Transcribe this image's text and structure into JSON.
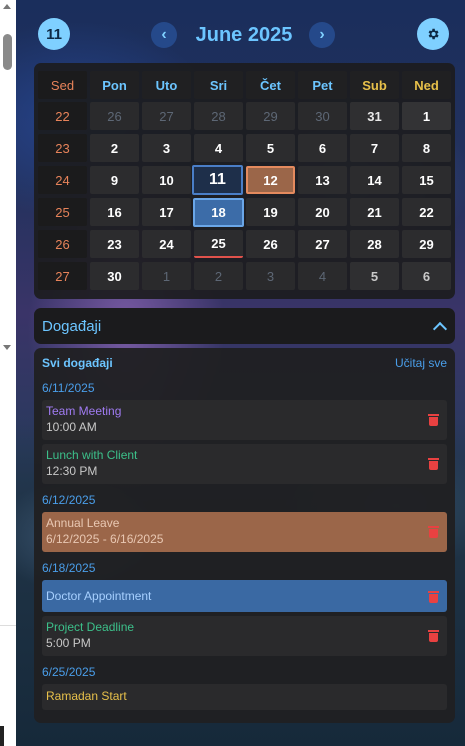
{
  "header": {
    "today_day": "11",
    "month_title": "June 2025",
    "prev_icon": "‹",
    "next_icon": "›"
  },
  "calendar": {
    "headers": [
      "Sed",
      "Pon",
      "Uto",
      "Sri",
      "Čet",
      "Pet",
      "Sub",
      "Ned"
    ],
    "weeks": [
      {
        "week": "22",
        "days": [
          "26",
          "27",
          "28",
          "29",
          "30",
          "31",
          "1"
        ]
      },
      {
        "week": "23",
        "days": [
          "2",
          "3",
          "4",
          "5",
          "6",
          "7",
          "8"
        ]
      },
      {
        "week": "24",
        "days": [
          "9",
          "10",
          "11",
          "12",
          "13",
          "14",
          "15"
        ]
      },
      {
        "week": "25",
        "days": [
          "16",
          "17",
          "18",
          "19",
          "20",
          "21",
          "22"
        ]
      },
      {
        "week": "26",
        "days": [
          "23",
          "24",
          "25",
          "26",
          "27",
          "28",
          "29"
        ]
      },
      {
        "week": "27",
        "days": [
          "30",
          "1",
          "2",
          "3",
          "4",
          "5",
          "6"
        ]
      }
    ]
  },
  "events_section": {
    "title": "Događaji",
    "all_label": "Svi događaji",
    "load_label": "Učitaj sve",
    "groups": [
      {
        "date": "6/11/2025",
        "items": [
          {
            "name": "Team Meeting",
            "time": "10:00 AM",
            "color": "#a07bf2"
          },
          {
            "name": "Lunch with Client",
            "time": "12:30 PM",
            "color": "#3cc08a"
          }
        ]
      },
      {
        "date": "6/12/2025",
        "items": [
          {
            "name": "Annual Leave",
            "time": "6/12/2025 - 6/16/2025",
            "color": "#e9c8b3"
          }
        ]
      },
      {
        "date": "6/18/2025",
        "items": [
          {
            "name": "Doctor Appointment",
            "time": "",
            "color": "#a7d0ff"
          },
          {
            "name": "Project Deadline",
            "time": "5:00 PM",
            "color": "#3cc08a"
          }
        ]
      },
      {
        "date": "6/25/2025",
        "items": [
          {
            "name": "Ramadan Start",
            "time": "",
            "color": "#e7c04a"
          }
        ]
      }
    ]
  }
}
